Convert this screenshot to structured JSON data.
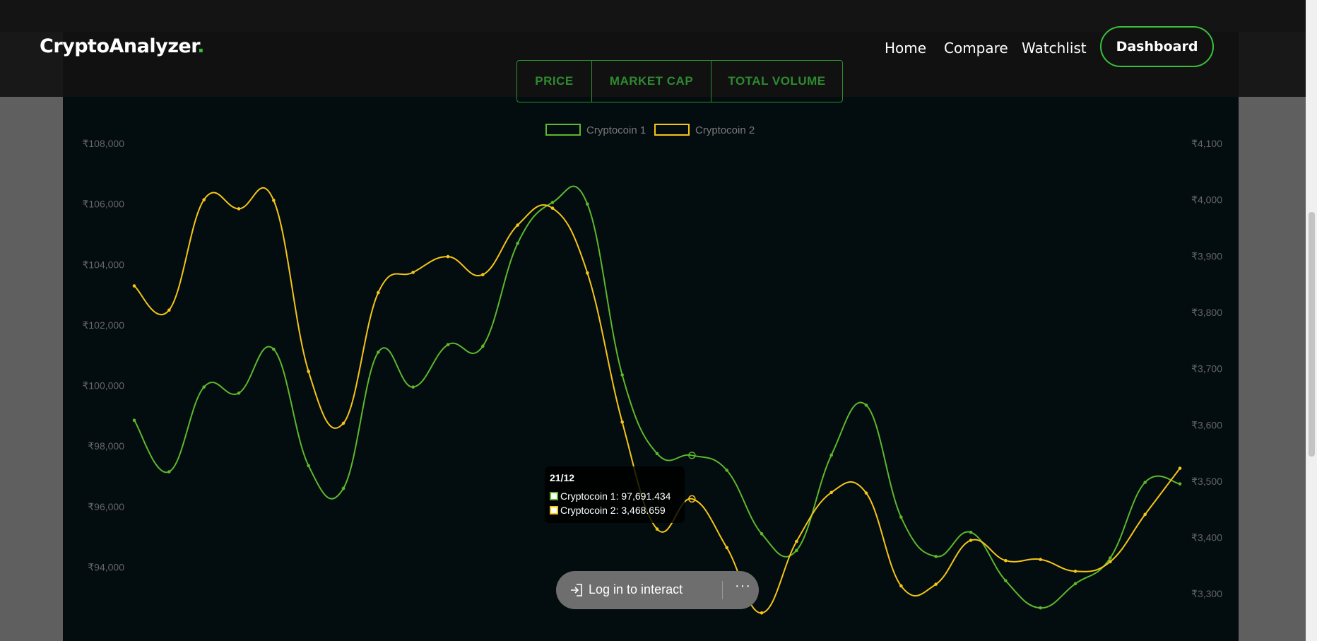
{
  "navbar": {
    "logo_text": "CryptoAnalyzer",
    "logo_dot": ".",
    "links": [
      "Home",
      "Compare",
      "Watchlist"
    ],
    "dashboard_label": "Dashboard"
  },
  "toggle": {
    "options": [
      "PRICE",
      "MARKET CAP",
      "TOTAL VOLUME"
    ],
    "selected": "PRICE"
  },
  "tooltip": {
    "date": "21/12",
    "rows": [
      "Cryptocoin 1: 97,691.434",
      "Cryptocoin 2: 3,468.659"
    ]
  },
  "login": {
    "label": "Log in to interact",
    "more": "···"
  },
  "colors": {
    "coin1": "#5cb82c",
    "coin2": "#f5c518",
    "accent": "#3ac13a",
    "background": "#030c0f"
  },
  "chart_data": {
    "type": "line",
    "legend": [
      "Cryptocoin 1",
      "Cryptocoin 2"
    ],
    "legend_position": "top",
    "grid": false,
    "y_left": {
      "ticks": [
        "₹94,000",
        "₹96,000",
        "₹98,000",
        "₹100,000",
        "₹102,000",
        "₹104,000",
        "₹106,000",
        "₹108,000"
      ],
      "range": [
        92000,
        108000
      ]
    },
    "y_right": {
      "ticks": [
        "₹3,300",
        "₹3,400",
        "₹3,500",
        "₹3,600",
        "₹3,700",
        "₹3,800",
        "₹3,900",
        "₹4,000",
        "₹4,100"
      ],
      "range": [
        3240,
        4100
      ]
    },
    "series": [
      {
        "name": "Cryptocoin 1",
        "axis": "left",
        "values": [
          98850,
          97150,
          99950,
          99750,
          101200,
          97350,
          96600,
          101100,
          99950,
          101350,
          101300,
          104700,
          106050,
          106000,
          100350,
          97750,
          97691.434,
          97200,
          95100,
          94550,
          97700,
          99350,
          95650,
          94350,
          95150,
          93550,
          92650,
          93450,
          94300,
          96800,
          96750
        ]
      },
      {
        "name": "Cryptocoin 2",
        "axis": "right",
        "values": [
          3847,
          3804,
          4000,
          3984,
          3999,
          3695,
          3603,
          3835,
          3871,
          3899,
          3867,
          3955,
          3985,
          3870,
          3605,
          3415,
          3468.659,
          3382,
          3266,
          3393,
          3480,
          3479,
          3314,
          3317,
          3395,
          3359,
          3361,
          3340,
          3357,
          3441,
          3523
        ]
      }
    ]
  }
}
